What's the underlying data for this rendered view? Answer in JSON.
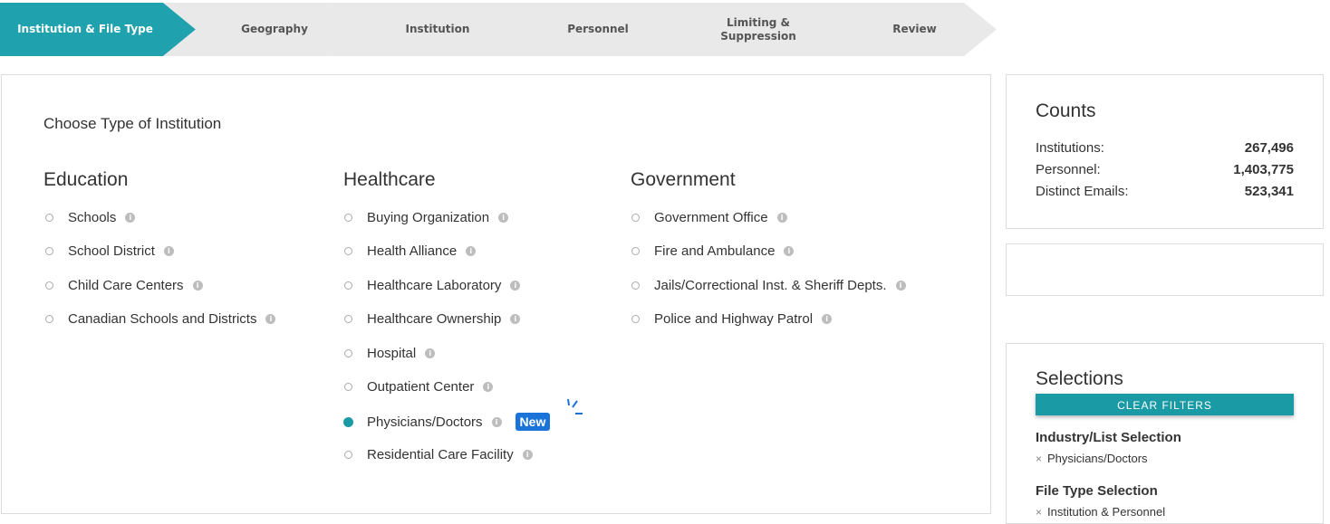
{
  "stepper": [
    {
      "label": "Institution & File Type",
      "active": true
    },
    {
      "label": "Geography",
      "active": false
    },
    {
      "label": "Institution",
      "active": false
    },
    {
      "label": "Personnel",
      "active": false
    },
    {
      "label": "Limiting &\nSuppression",
      "active": false
    },
    {
      "label": "Review",
      "active": false
    }
  ],
  "main": {
    "title": "Choose Type of Institution",
    "groups": [
      {
        "name": "Education",
        "options": [
          "Schools",
          "School District",
          "Child Care Centers",
          "Canadian Schools and Districts"
        ]
      },
      {
        "name": "Healthcare",
        "options": [
          "Buying Organization",
          "Health Alliance",
          "Healthcare Laboratory",
          "Healthcare Ownership",
          "Hospital",
          "Outpatient Center",
          "Physicians/Doctors",
          "Residential Care Facility"
        ]
      },
      {
        "name": "Government",
        "options": [
          "Government Office",
          "Fire and Ambulance",
          "Jails/Correctional Inst. & Sheriff Depts.",
          "Police and Highway Patrol"
        ]
      }
    ],
    "selected_option": "Physicians/Doctors",
    "new_badge": "New",
    "info_glyph": "i"
  },
  "counts": {
    "title": "Counts",
    "rows": [
      {
        "label": "Institutions:",
        "value": "267,496"
      },
      {
        "label": "Personnel:",
        "value": "1,403,775"
      },
      {
        "label": "Distinct Emails:",
        "value": "523,341"
      }
    ]
  },
  "selections": {
    "title": "Selections",
    "clear_label": "CLEAR FILTERS",
    "sections": [
      {
        "heading": "Industry/List Selection",
        "items": [
          "Physicians/Doctors"
        ]
      },
      {
        "heading": "File Type Selection",
        "items": [
          "Institution & Personnel"
        ]
      }
    ],
    "remove_glyph": "×"
  },
  "colors": {
    "accent": "#1fa2ad",
    "badge": "#1a73d9",
    "step_inactive": "#e9e9e9"
  }
}
